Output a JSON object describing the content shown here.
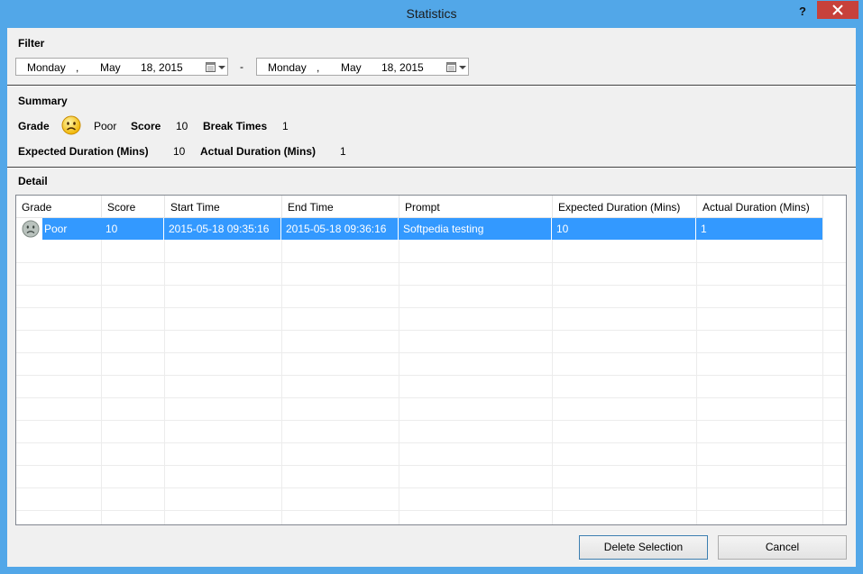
{
  "window": {
    "title": "Statistics",
    "help_label": "?"
  },
  "filter": {
    "label": "Filter",
    "from": {
      "weekday": "Monday",
      "sep": ",",
      "month": "May",
      "day_year": "18, 2015"
    },
    "range_sep": "-",
    "to": {
      "weekday": "Monday",
      "sep": ",",
      "month": "May",
      "day_year": "18, 2015"
    }
  },
  "summary": {
    "label": "Summary",
    "grade_label": "Grade",
    "grade_value": "Poor",
    "score_label": "Score",
    "score_value": "10",
    "break_label": "Break Times",
    "break_value": "1",
    "expected_label": "Expected Duration (Mins)",
    "expected_value": "10",
    "actual_label": "Actual Duration (Mins)",
    "actual_value": "1"
  },
  "detail": {
    "label": "Detail",
    "columns": [
      "Grade",
      "Score",
      "Start Time",
      "End Time",
      "Prompt",
      "Expected Duration (Mins)",
      "Actual Duration (Mins)"
    ],
    "rows": [
      [
        "Poor",
        "10",
        "2015-05-18 09:35:16",
        "2015-05-18 09:36:16",
        "Softpedia testing",
        "10",
        "1"
      ]
    ]
  },
  "buttons": {
    "delete_label": "Delete Selection",
    "cancel_label": "Cancel"
  },
  "colors": {
    "title_bar": "#52a7e8",
    "close_button": "#c7413b",
    "selection": "#3399ff"
  }
}
